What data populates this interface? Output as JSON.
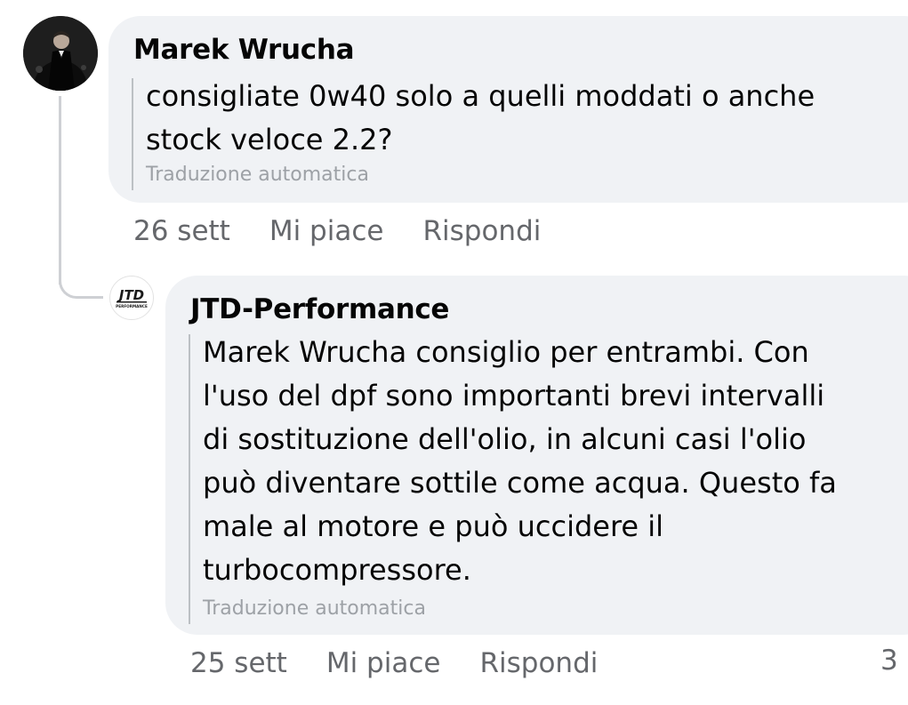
{
  "comments": [
    {
      "author": "Marek Wrucha",
      "lines": [
        "consigliate 0w40 solo a quelli moddati o anche",
        "stock veloce 2.2?"
      ],
      "translation_note": "Traduzione automatica",
      "time": "26 sett",
      "like_label": "Mi piace",
      "reply_label": "Rispondi"
    },
    {
      "author": "JTD-Performance",
      "avatar_text": "JTD",
      "avatar_subtext": "PERFORMANCE",
      "lines": [
        "Marek Wrucha consiglio per entrambi. Con",
        "l'uso del dpf sono importanti brevi intervalli",
        "di sostituzione dell'olio, in alcuni casi l'olio",
        "può diventare sottile come acqua. Questo fa",
        "male al motore e può uccidere il",
        "turbocompressore."
      ],
      "translation_note": "Traduzione automatica",
      "time": "25 sett",
      "like_label": "Mi piace",
      "reply_label": "Rispondi",
      "reaction_count_partial": "3"
    }
  ],
  "colors": {
    "bubble": "#f0f2f5",
    "meta_text": "#65676b",
    "translation_text": "#9da1a6",
    "thread_line": "#ced0d4"
  }
}
